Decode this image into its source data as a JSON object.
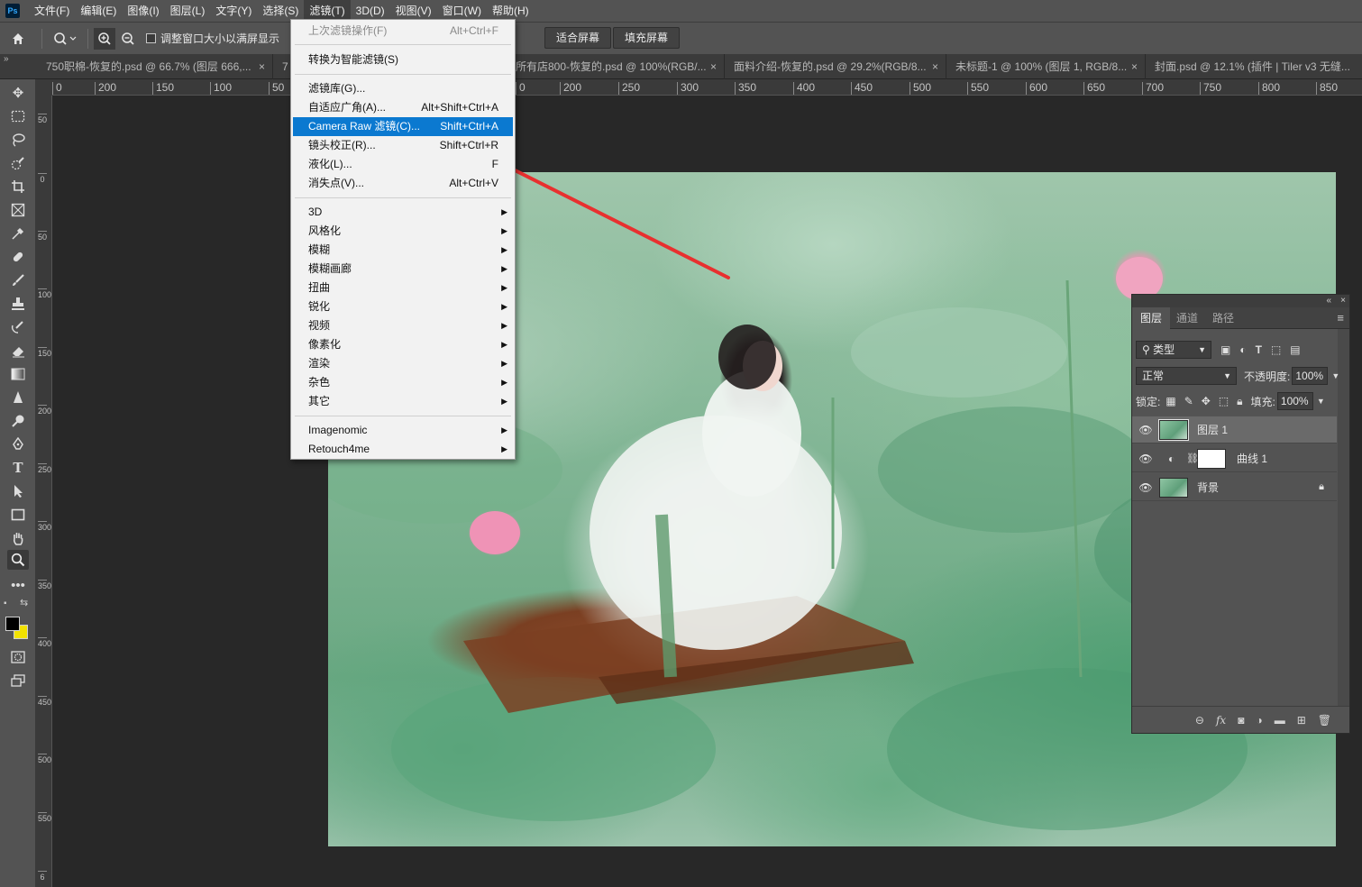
{
  "menubar": {
    "logo": "Ps",
    "items": [
      "文件(F)",
      "编辑(E)",
      "图像(I)",
      "图层(L)",
      "文字(Y)",
      "选择(S)",
      "滤镜(T)",
      "3D(D)",
      "视图(V)",
      "窗口(W)",
      "帮助(H)"
    ]
  },
  "options": {
    "checkbox_label": "调整窗口大小以满屏显示",
    "btn_fit": "适合屏幕",
    "btn_fill": "填充屏幕"
  },
  "tabs": [
    {
      "label": "750职棉-恢复的.psd @ 66.7% (图层 666,...",
      "close": "×"
    },
    {
      "label": "7",
      "close": ""
    },
    {
      "label": "所有店800-恢复的.psd @ 100%(RGB/...",
      "close": "×"
    },
    {
      "label": "面料介绍-恢复的.psd @ 29.2%(RGB/8...",
      "close": "×"
    },
    {
      "label": "未标题-1 @ 100% (图层 1, RGB/8...",
      "close": "×"
    },
    {
      "label": "封面.psd @ 12.1% (插件 | Tiler v3  无缝...",
      "close": ""
    }
  ],
  "ruler": {
    "h_left": [
      "0",
      "200",
      "150",
      "100",
      "50"
    ],
    "h_right": [
      "0",
      "200",
      "250",
      "300",
      "350",
      "400",
      "450",
      "500",
      "550",
      "600",
      "650",
      "700",
      "750",
      "800",
      "850"
    ],
    "v": [
      "50",
      "0",
      "50",
      "100",
      "150",
      "200",
      "250",
      "300",
      "350",
      "400",
      "450",
      "500",
      "550",
      "6"
    ]
  },
  "filter_menu": {
    "items": [
      {
        "label": "上次滤镜操作(F)",
        "shortcut": "Alt+Ctrl+F",
        "disabled": true
      },
      {
        "label": "转换为智能滤镜(S)",
        "shortcut": ""
      },
      {
        "label": "滤镜库(G)...",
        "shortcut": ""
      },
      {
        "label": "自适应广角(A)...",
        "shortcut": "Alt+Shift+Ctrl+A"
      },
      {
        "label": "Camera Raw 滤镜(C)...",
        "shortcut": "Shift+Ctrl+A",
        "highlighted": true
      },
      {
        "label": "镜头校正(R)...",
        "shortcut": "Shift+Ctrl+R"
      },
      {
        "label": "液化(L)...",
        "shortcut": "F"
      },
      {
        "label": "消失点(V)...",
        "shortcut": "Alt+Ctrl+V"
      },
      {
        "label": "3D",
        "submenu": true
      },
      {
        "label": "风格化",
        "submenu": true
      },
      {
        "label": "模糊",
        "submenu": true
      },
      {
        "label": "模糊画廊",
        "submenu": true
      },
      {
        "label": "扭曲",
        "submenu": true
      },
      {
        "label": "锐化",
        "submenu": true
      },
      {
        "label": "视频",
        "submenu": true
      },
      {
        "label": "像素化",
        "submenu": true
      },
      {
        "label": "渲染",
        "submenu": true
      },
      {
        "label": "杂色",
        "submenu": true
      },
      {
        "label": "其它",
        "submenu": true
      },
      {
        "label": "Imagenomic",
        "submenu": true
      },
      {
        "label": "Retouch4me",
        "submenu": true
      }
    ]
  },
  "layers_panel": {
    "tabs": [
      "图层",
      "通道",
      "路径"
    ],
    "filter_kind": "类型",
    "blend_mode": "正常",
    "opacity_label": "不透明度:",
    "opacity_value": "100%",
    "lock_label": "锁定:",
    "fill_label": "填充:",
    "fill_value": "100%",
    "layers": [
      {
        "name": "图层 1",
        "selected": true
      },
      {
        "name": "曲线 1",
        "adjustment": true
      },
      {
        "name": "背景",
        "locked": true
      }
    ]
  },
  "colors": {
    "accent": "#0b79d0",
    "arrow": "#e8302f",
    "foreground": "#000000",
    "background": "#f2e200"
  }
}
